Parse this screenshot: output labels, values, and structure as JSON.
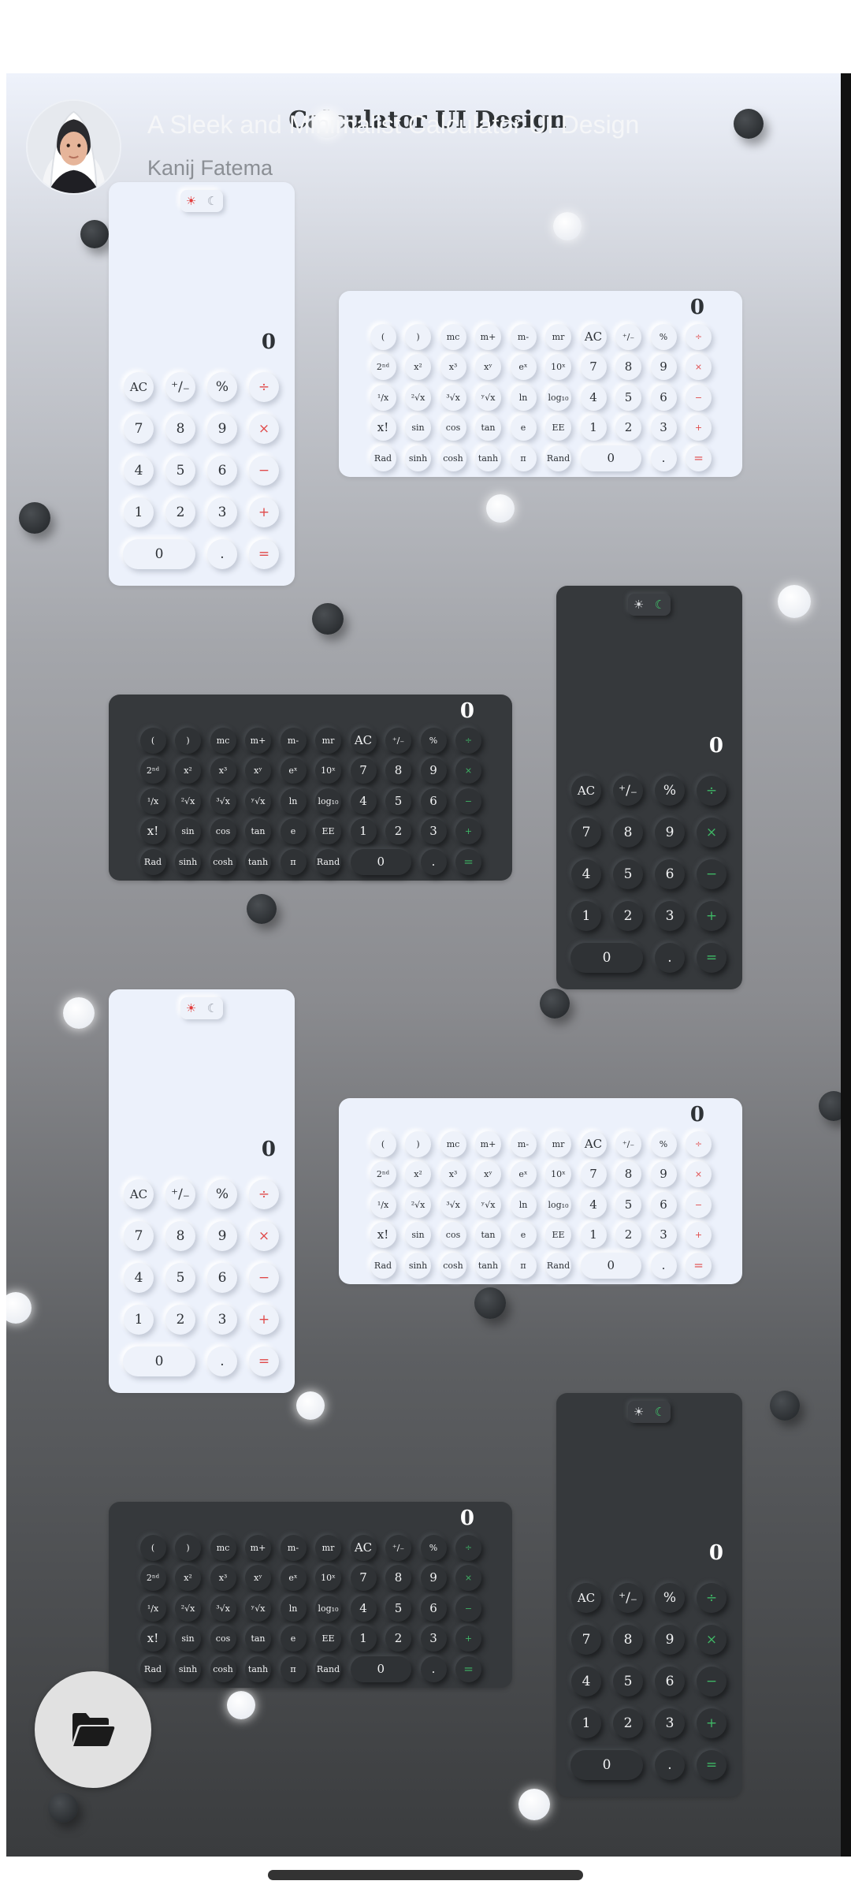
{
  "overlay": {
    "title": "A Sleek and Minimalist Calculator UI Design",
    "author": "Kanij Fatema"
  },
  "artwork": {
    "title": "Calculator UI Design"
  },
  "fab": {
    "icon": "folder-open-icon"
  },
  "calculators": [
    {
      "theme": "light",
      "layout": "basic",
      "display": "0"
    },
    {
      "theme": "light",
      "layout": "scientific",
      "display": "0"
    },
    {
      "theme": "dark",
      "layout": "basic",
      "display": "0"
    },
    {
      "theme": "dark",
      "layout": "scientific",
      "display": "0"
    },
    {
      "theme": "light",
      "layout": "basic",
      "display": "0"
    },
    {
      "theme": "light",
      "layout": "scientific",
      "display": "0"
    },
    {
      "theme": "dark",
      "layout": "basic",
      "display": "0"
    },
    {
      "theme": "dark",
      "layout": "scientific",
      "display": "0"
    }
  ],
  "theme_toggle": {
    "sun": "☀",
    "moon": "☾"
  },
  "basic_keys": [
    [
      "AC",
      "⁺∕₋",
      "%",
      "÷"
    ],
    [
      "7",
      "8",
      "9",
      "×"
    ],
    [
      "4",
      "5",
      "6",
      "−"
    ],
    [
      "1",
      "2",
      "3",
      "+"
    ],
    [
      "0",
      ".",
      "="
    ]
  ],
  "scientific_keys": [
    [
      "(",
      ")",
      "mc",
      "m+",
      "m-",
      "mr",
      "AC",
      "⁺∕₋",
      "%",
      "÷"
    ],
    [
      "2ⁿᵈ",
      "x²",
      "x³",
      "xʸ",
      "eˣ",
      "10ˣ",
      "7",
      "8",
      "9",
      "×"
    ],
    [
      "¹/x",
      "²√x",
      "³√x",
      "ʸ√x",
      "ln",
      "log₁₀",
      "4",
      "5",
      "6",
      "−"
    ],
    [
      "x!",
      "sin",
      "cos",
      "tan",
      "e",
      "EE",
      "1",
      "2",
      "3",
      "+"
    ],
    [
      "Rad",
      "sinh",
      "cosh",
      "tanh",
      "π",
      "Rand",
      "0",
      ".",
      "="
    ]
  ],
  "colors": {
    "light_accent": "#e04848",
    "dark_accent": "#3fb866",
    "light_surface": "#ecf1fb",
    "dark_surface": "#36393c"
  }
}
